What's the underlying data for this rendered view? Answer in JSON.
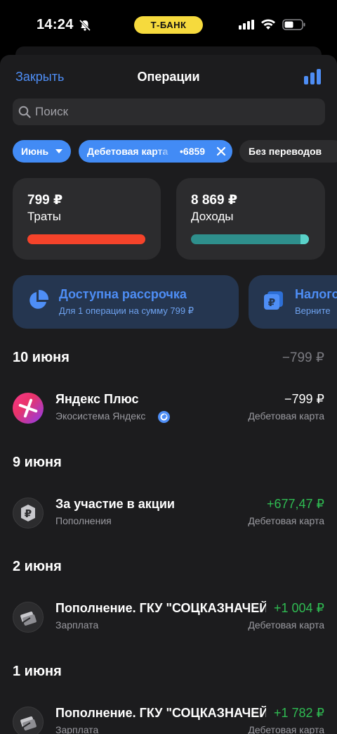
{
  "status_bar": {
    "time": "14:24",
    "bank_badge": "Т-БАНК"
  },
  "nav": {
    "close": "Закрыть",
    "title": "Операции"
  },
  "search": {
    "placeholder": "Поиск"
  },
  "chips": {
    "month": "Июнь",
    "card_label": "Дебетовая карта",
    "card_number": "•6859",
    "transfers": "Без переводов"
  },
  "summary": {
    "spend_amount": "799 ₽",
    "spend_label": "Траты",
    "income_amount": "8 869 ₽",
    "income_label": "Доходы"
  },
  "promos": [
    {
      "title": "Доступна рассрочка",
      "subtitle": "Для 1 операции на сумму 799 ₽",
      "icon": "pie-chart-icon"
    },
    {
      "title": "Налоговый",
      "subtitle": "Верните",
      "icon": "ruble-cards-icon"
    }
  ],
  "days": [
    {
      "date": "10 июня",
      "total": "−799 ₽",
      "transactions": [
        {
          "title": "Яндекс Плюс",
          "subtitle": "Экосистема Яндекс",
          "amount": "−799 ₽",
          "card": "Дебетовая карта",
          "icon": "yandex-plus-icon"
        }
      ]
    },
    {
      "date": "9 июня",
      "transactions": [
        {
          "title": "За участие в акции",
          "subtitle": "Пополнения",
          "amount": "+677,47 ₽",
          "card": "Дебетовая карта",
          "icon": "ruble-coin-icon"
        }
      ]
    },
    {
      "date": "2 июня",
      "transactions": [
        {
          "title": "Пополнение. ГКУ \"СОЦКАЗНАЧЕЙСТВО\"",
          "subtitle": "Зарплата",
          "amount": "+1 004 ₽",
          "card": "Дебетовая карта",
          "icon": "salary-card-icon"
        }
      ]
    },
    {
      "date": "1 июня",
      "transactions": [
        {
          "title": "Пополнение. ГКУ \"СОЦКАЗНАЧЕЙСТВО\"",
          "subtitle": "Зарплата",
          "amount": "+1 782 ₽",
          "card": "Дебетовая карта",
          "icon": "salary-card-icon"
        }
      ]
    }
  ],
  "colors": {
    "accent": "#428bf5",
    "spend_bar": "#f5432a",
    "income_bar": "#2e8f8c",
    "positive": "#2fbb52",
    "bank_yellow": "#f6da3d"
  }
}
